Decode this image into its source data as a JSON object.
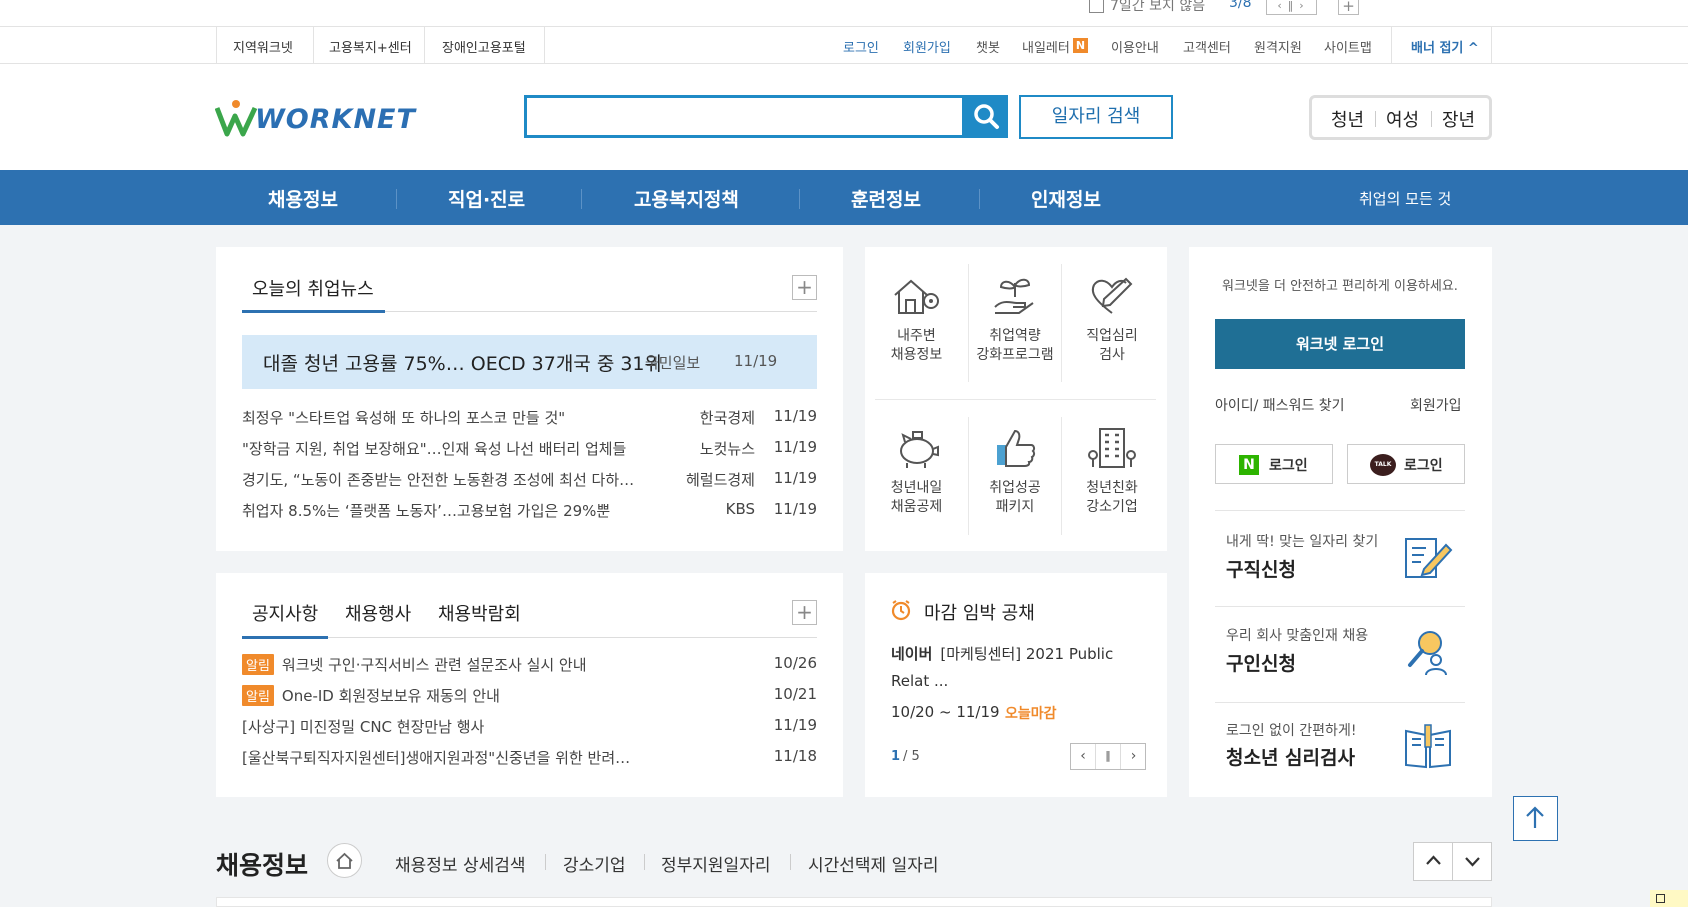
{
  "banner": {
    "hide_7days": "7일간 보지 않음",
    "counter": "3/8"
  },
  "util": {
    "left_links": [
      "지역워크넷",
      "고용복지+센터",
      "장애인고용포털"
    ],
    "right_links": [
      "로그인",
      "회원가입",
      "챗봇",
      "내일레터",
      "이용안내",
      "고객센터",
      "원격지원",
      "사이트맵"
    ],
    "letter_badge": "N",
    "fold_banner": "배너 접기"
  },
  "header": {
    "logo": "WORKNET",
    "job_search_button": "일자리 검색",
    "target_tabs": [
      "청년",
      "여성",
      "장년"
    ]
  },
  "gnb": {
    "items": [
      "채용정보",
      "직업·진로",
      "고용복지정책",
      "훈련정보",
      "인재정보"
    ],
    "right": "취업의 모든 것"
  },
  "news": {
    "tab": "오늘의 취업뉴스",
    "highlight": {
      "title": "대졸 청년 고용률 75%… OECD 37개국 중 31위",
      "source": "국민일보",
      "date": "11/19"
    },
    "items": [
      {
        "title": "최정우 \"스타트업 육성해 또 하나의 포스코 만들 것\"",
        "source": "한국경제",
        "date": "11/19"
      },
      {
        "title": "\"장학금 지원, 취업 보장해요\"…인재 육성 나선 배터리 업체들",
        "source": "노컷뉴스",
        "date": "11/19"
      },
      {
        "title": "경기도, “노동이 존중받는 안전한 노동환경 조성에 최선 다하…",
        "source": "헤럴드경제",
        "date": "11/19"
      },
      {
        "title": "취업자 8.5%는 ‘플랫폼 노동자’…고용보험 가입은 29%뿐",
        "source": "KBS",
        "date": "11/19"
      }
    ]
  },
  "quick": {
    "items": [
      {
        "line1": "내주변",
        "line2": "채용정보",
        "icon": "house-location-icon"
      },
      {
        "line1": "취업역량",
        "line2": "강화프로그램",
        "icon": "sprout-hand-icon"
      },
      {
        "line1": "직업심리",
        "line2": "검사",
        "icon": "heart-pen-icon"
      },
      {
        "line1": "청년내일",
        "line2": "채움공제",
        "icon": "piggy-bank-icon"
      },
      {
        "line1": "취업성공",
        "line2": "패키지",
        "icon": "thumbs-up-icon"
      },
      {
        "line1": "청년친화",
        "line2": "강소기업",
        "icon": "building-icon"
      }
    ]
  },
  "login": {
    "intro": "워크넷을 더 안전하고 편리하게 이용하세요.",
    "button": "워크넷 로그인",
    "find": "아이디/ 패스워드 찾기",
    "join": "회원가입",
    "naver": "로그인",
    "naver_mark": "N",
    "kakao": "로그인",
    "kakao_mark": "TALK"
  },
  "services": [
    {
      "sub": "내게 딱! 맞는 일자리 찾기",
      "title": "구직신청",
      "icon": "resume-pen-icon"
    },
    {
      "sub": "우리 회사 맞춤인재 채용",
      "title": "구인신청",
      "icon": "person-search-icon"
    },
    {
      "sub": "로그인 없이 간편하게!",
      "title": "청소년 심리검사",
      "icon": "open-book-icon"
    }
  ],
  "notice": {
    "tabs": [
      "공지사항",
      "채용행사",
      "채용박람회"
    ],
    "items": [
      {
        "badge": "알림",
        "title": "워크넷 구인·구직서비스 관련 설문조사 실시 안내",
        "date": "10/26"
      },
      {
        "badge": "알림",
        "title": "One-ID 회원정보보유 재동의 안내",
        "date": "10/21"
      },
      {
        "badge": "",
        "title": "[사상구] 미진정밀 CNC 현장만남 행사",
        "date": "11/19"
      },
      {
        "badge": "",
        "title": "[울산북구퇴직자지원센터]생애지원과정\"신중년을 위한 반려…",
        "date": "11/18"
      }
    ]
  },
  "deadline": {
    "title": "마감 임박 공채",
    "company": "네이버",
    "posting": "[마케팅센터] 2021 Public Relat ...",
    "period": "10/20 ~ 11/19",
    "status": "오늘마감",
    "page_current": "1",
    "page_total": "/ 5"
  },
  "bottom": {
    "title": "채용정보",
    "links": [
      "채용정보 상세검색",
      "강소기업",
      "정부지원일자리",
      "시간선택제 일자리"
    ]
  },
  "colors": {
    "navy": "#2d71b1",
    "login": "#1f6f95",
    "highlight": "#d6e9f8",
    "orange": "#f08a2b",
    "search_border": "#1f8ac6"
  }
}
